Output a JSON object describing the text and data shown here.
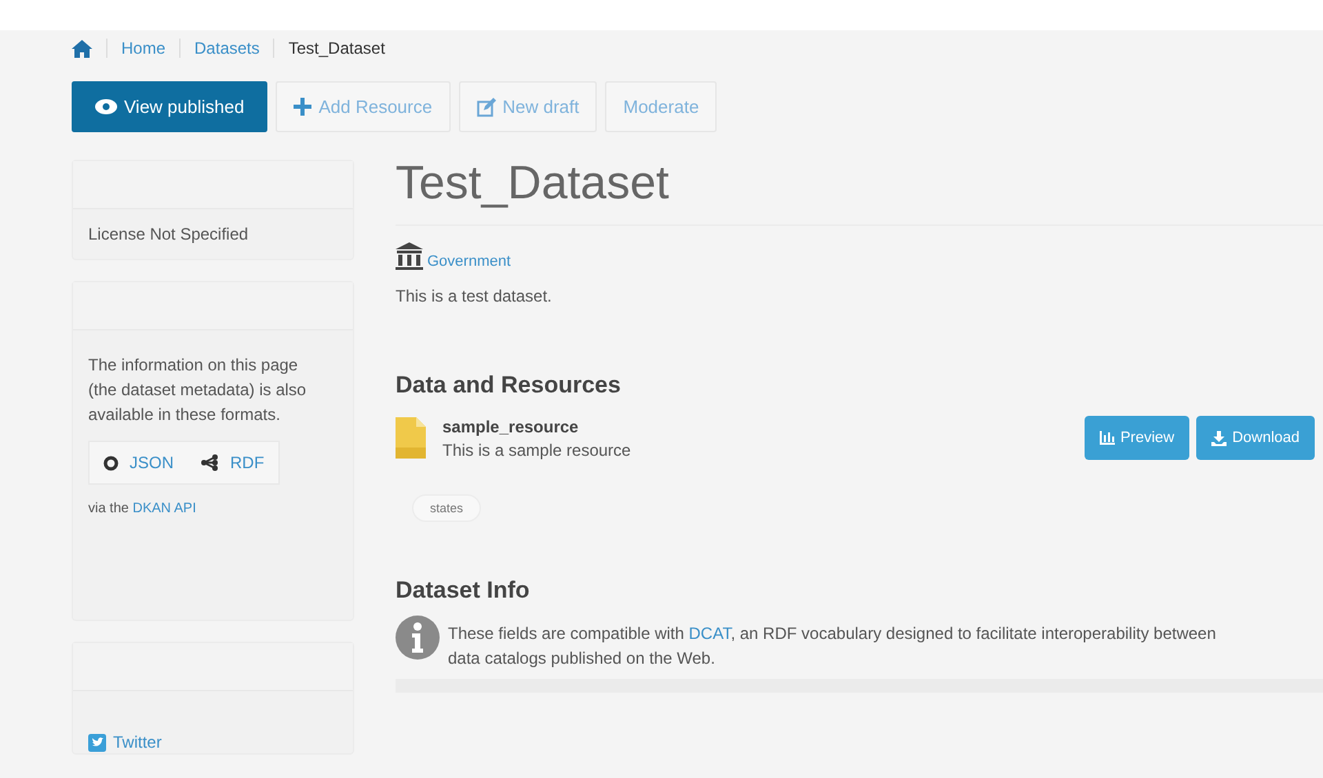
{
  "breadcrumb": [
    {
      "label": "Home",
      "link": true
    },
    {
      "label": "Datasets",
      "link": true
    },
    {
      "label": "Test_Dataset",
      "link": false
    }
  ],
  "actions": [
    {
      "label": "View published",
      "selected": true
    },
    {
      "label": "Add Resource",
      "selected": false
    },
    {
      "label": "New draft",
      "selected": false
    },
    {
      "label": "Moderate",
      "selected": false
    }
  ],
  "sidebar": {
    "license": "License Not Specified",
    "formats_text": "The information on this page (the dataset metadata) is also available in these formats.",
    "formats": [
      {
        "label": "JSON"
      },
      {
        "label": "RDF"
      }
    ],
    "api_prefix": "via the ",
    "api_link": "DKAN API",
    "social": [
      {
        "label": "Twitter"
      }
    ]
  },
  "main": {
    "title": "Test_Dataset",
    "group": "Government",
    "description": "This is a test dataset.",
    "resources_heading": "Data and Resources",
    "resources": [
      {
        "name": "sample_resource",
        "description": "This is a sample resource",
        "buttons": [
          {
            "label": "Preview"
          },
          {
            "label": "Download"
          }
        ]
      }
    ],
    "tags": [
      "states"
    ],
    "info_heading": "Dataset Info",
    "info": {
      "before": "These fields are compatible with ",
      "link": "DCAT",
      "after": ", an RDF vocabulary designed to facilitate interoperability between data catalogs published on the Web."
    }
  }
}
